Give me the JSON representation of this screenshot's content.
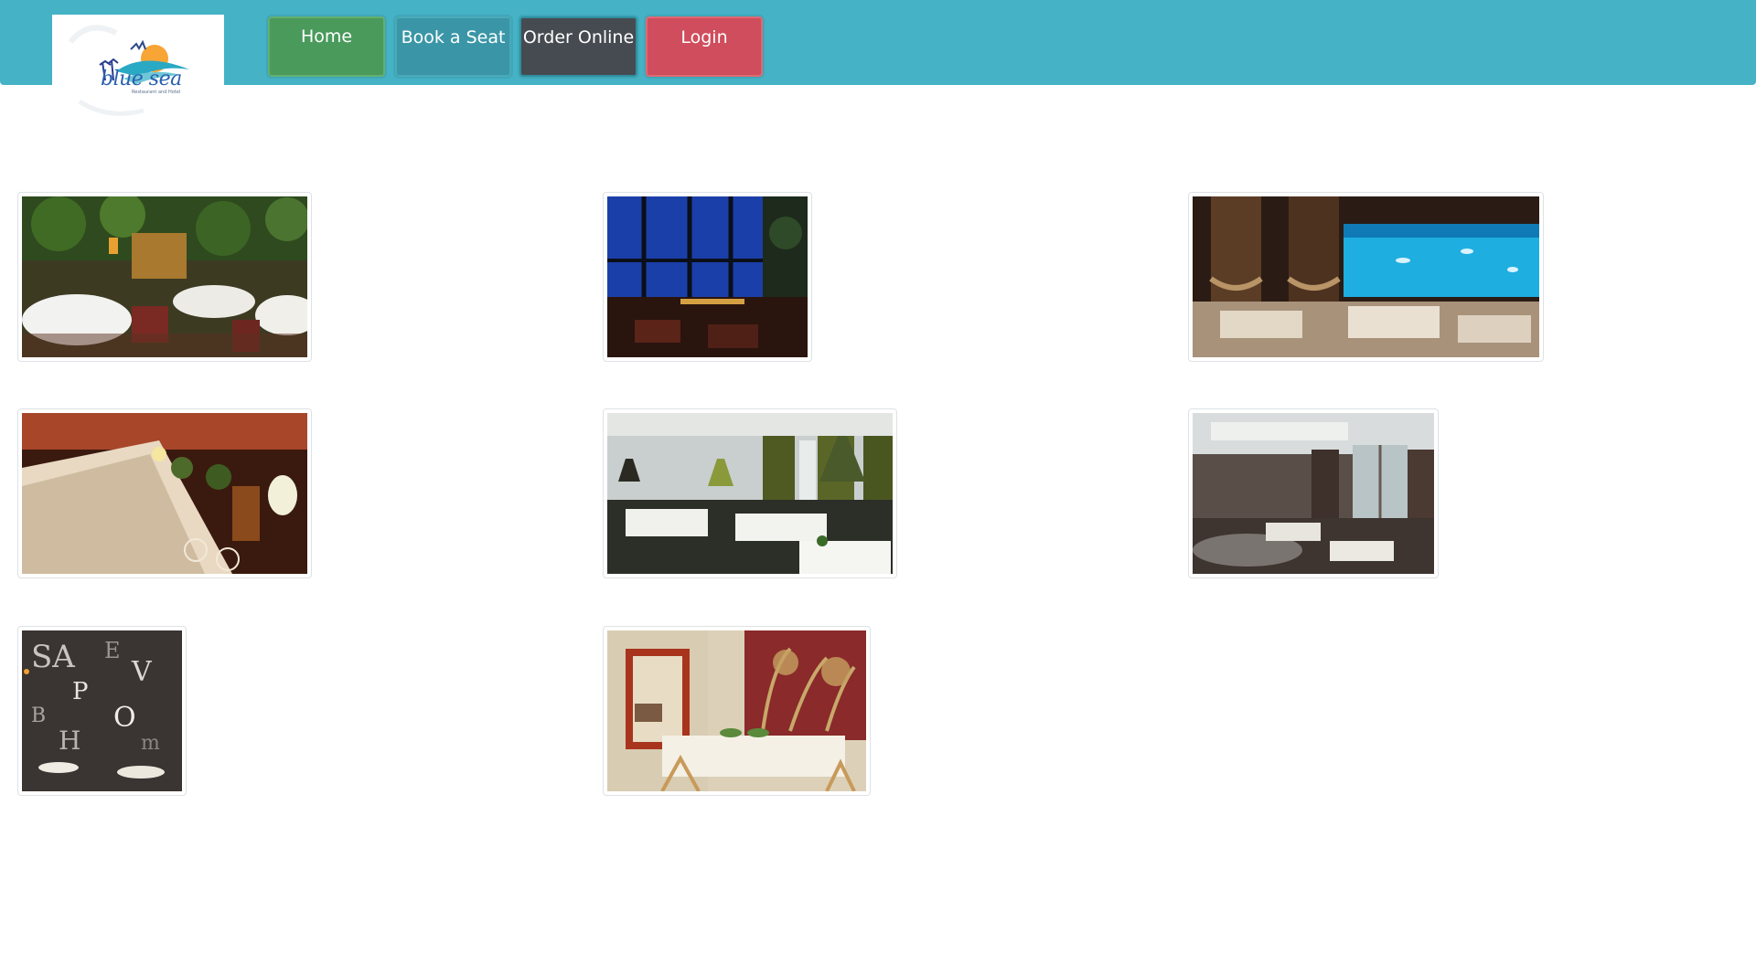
{
  "brand": {
    "name": "blue sea",
    "tagline": "Restaurant and Hotel"
  },
  "nav": {
    "home": "Home",
    "book": "Book a Seat",
    "order": "Order Online",
    "login": "Login"
  },
  "colors": {
    "header": "#45b2c5",
    "home_button": "#4a9a5c",
    "book_button": "#3a96a7",
    "order_button": "#464b51",
    "login_button": "#cf4d5c"
  },
  "gallery": {
    "images": [
      {
        "subject": "restaurant-interior-courtyard"
      },
      {
        "subject": "restaurant-night-city-view"
      },
      {
        "subject": "restaurant-aquarium-wall"
      },
      {
        "subject": "banquet-table-setting"
      },
      {
        "subject": "restaurant-green-curtains"
      },
      {
        "subject": "restaurant-modern-atrium"
      },
      {
        "subject": "cafe-letter-wall"
      },
      {
        "subject": "dining-room-red-mural"
      }
    ]
  }
}
